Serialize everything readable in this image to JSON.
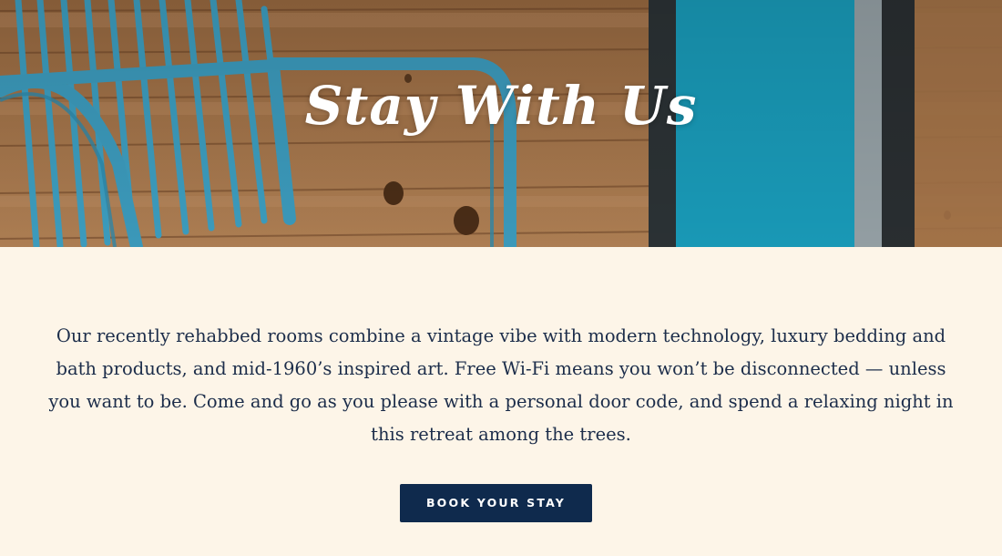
{
  "hero": {
    "title": "Stay With Us",
    "image_description_icon": "hero-photo-blue-chair-wood-wall"
  },
  "main": {
    "description": "Our recently rehabbed rooms combine a vintage vibe with modern technology, luxury bedding and bath products, and mid-1960’s inspired art. Free Wi-Fi means you won’t be disconnected — unless you want to be. Come and go as you please with a personal door code, and spend a relaxing night in this retreat among the trees.",
    "cta_label": "BOOK YOUR STAY"
  },
  "colors": {
    "background": "#fdf5e8",
    "text": "#1c2d4a",
    "button": "#0f2a4d",
    "chair": "#3fa3c6",
    "door": "#1aa0bf",
    "wood": "#a7774a"
  }
}
